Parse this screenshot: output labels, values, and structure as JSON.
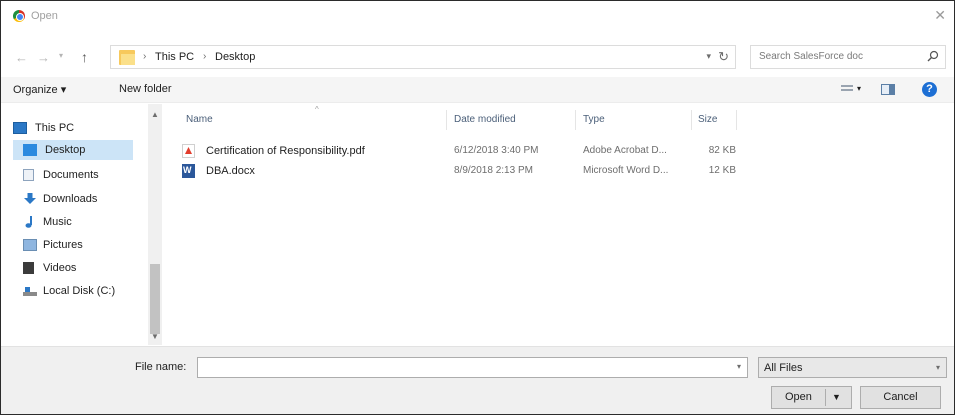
{
  "window": {
    "title": "Open"
  },
  "address": {
    "crumbs": [
      "This PC",
      "Desktop"
    ]
  },
  "search": {
    "placeholder": "Search SalesForce doc"
  },
  "toolbar": {
    "organize": "Organize ▾",
    "new_folder": "New folder",
    "help": "?"
  },
  "nav": {
    "items": [
      {
        "label": "This PC",
        "icon": "computer-icon"
      },
      {
        "label": "Desktop",
        "icon": "desktop-icon",
        "selected": true
      },
      {
        "label": "Documents",
        "icon": "documents-icon"
      },
      {
        "label": "Downloads",
        "icon": "downloads-icon"
      },
      {
        "label": "Music",
        "icon": "music-icon"
      },
      {
        "label": "Pictures",
        "icon": "pictures-icon"
      },
      {
        "label": "Videos",
        "icon": "videos-icon"
      },
      {
        "label": "Local Disk (C:)",
        "icon": "disk-icon"
      }
    ]
  },
  "list": {
    "columns": [
      "Name",
      "Date modified",
      "Type",
      "Size"
    ],
    "rows": [
      {
        "name": "Certification of Responsibility.pdf",
        "date": "6/12/2018 3:40 PM",
        "type": "Adobe Acrobat D...",
        "size": "82 KB",
        "icon": "pdf-file-icon"
      },
      {
        "name": "DBA.docx",
        "date": "8/9/2018 2:13 PM",
        "type": "Microsoft Word D...",
        "size": "12 KB",
        "icon": "word-file-icon"
      }
    ]
  },
  "bottom": {
    "filename_label": "File name:",
    "filename_value": "",
    "filter": "All Files",
    "open": "Open",
    "cancel": "Cancel"
  }
}
